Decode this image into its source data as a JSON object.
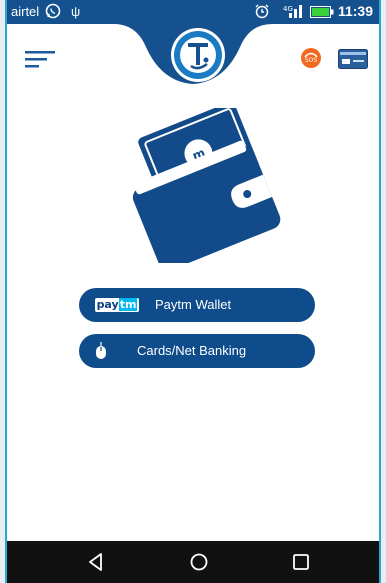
{
  "status_bar": {
    "carrier": "airtel",
    "usb_glyph": "ψ",
    "time": "11:39",
    "icons": [
      "whatsapp-icon",
      "usb-icon",
      "alarm-icon",
      "signal-icon",
      "battery-icon"
    ]
  },
  "header": {
    "menu_icon": "hamburger-menu-icon",
    "logo_icon": "app-logo",
    "sos_label": "SOS",
    "card_icon": "card-icon"
  },
  "main": {
    "illustration": "wallet-icon",
    "payment_options": [
      {
        "label": "Paytm Wallet",
        "logo_text_1": "pay",
        "logo_text_2": "tm"
      },
      {
        "label": "Cards/Net Banking"
      }
    ]
  },
  "nav_bar": {
    "icons": [
      "back-icon",
      "home-icon",
      "recent-apps-icon"
    ]
  },
  "colors": {
    "primary": "#0f4c8c",
    "status_bar": "#16518f",
    "sos": "#f26a21",
    "frame_border": "#27a9d6"
  }
}
